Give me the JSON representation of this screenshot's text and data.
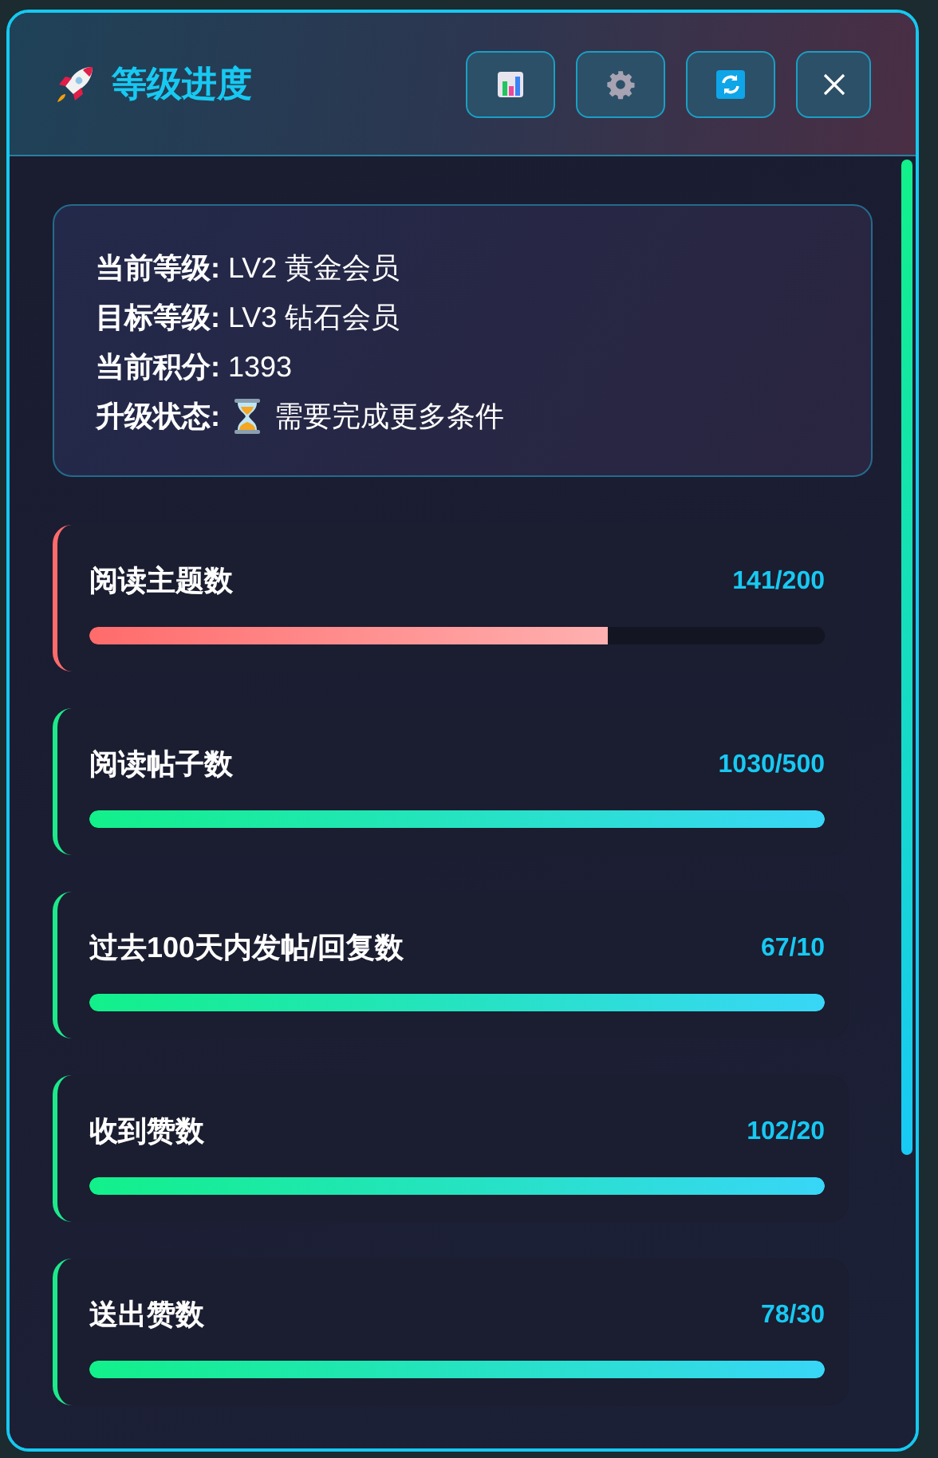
{
  "header": {
    "title": "等级进度",
    "buttons": [
      {
        "kind": "chart"
      },
      {
        "kind": "settings"
      },
      {
        "kind": "refresh"
      },
      {
        "kind": "close"
      }
    ]
  },
  "info": [
    {
      "kind": "text",
      "text": "**当前等级:** LV2 黄金会员"
    },
    {
      "kind": "text",
      "text": "**目标等级:** LV3 钻石会员"
    },
    {
      "kind": "text",
      "text": "**当前积分:** 1393"
    },
    {
      "kind": "status",
      "label": "升级状态:",
      "value": "需要完成更多条件"
    }
  ],
  "requirements": [
    {
      "name": "阅读主题数",
      "value": "141/200",
      "met": false,
      "level": 0.705
    },
    {
      "name": "阅读帖子数",
      "value": "1030/500",
      "met": true,
      "level": 1
    },
    {
      "name": "过去100天内发帖/回复数",
      "value": "67/10",
      "met": true,
      "level": 1
    },
    {
      "name": "收到赞数",
      "value": "102/20",
      "met": true,
      "level": 1
    },
    {
      "name": "送出赞数",
      "value": "78/30",
      "met": true,
      "level": 1
    }
  ]
}
